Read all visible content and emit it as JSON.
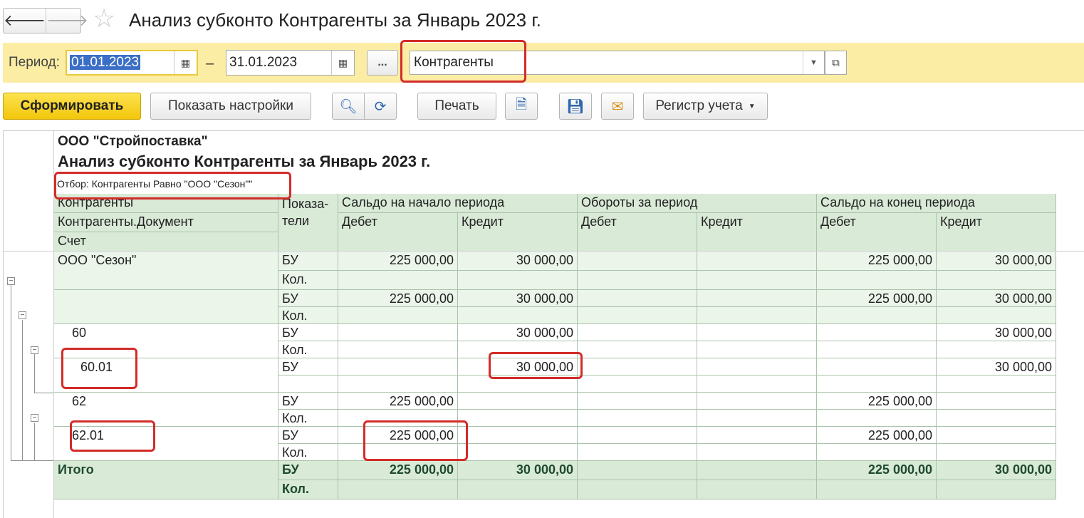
{
  "window": {
    "back_icon": "arrow-left-icon",
    "forward_icon": "arrow-right-icon",
    "favorite_icon": "star-icon",
    "title": "Анализ субконто Контрагенты за Январь 2023 г."
  },
  "period": {
    "label": "Период:",
    "from": "01.01.2023",
    "to": "31.01.2023",
    "dash": "–",
    "dots_label": "...",
    "subconto": "Контрагенты"
  },
  "toolbar": {
    "generate": "Сформировать",
    "show_settings": "Показать настройки",
    "print": "Печать",
    "register": "Регистр учета"
  },
  "report": {
    "org": "ООО \"Стройпоставка\"",
    "title": "Анализ субконто Контрагенты за Январь 2023 г.",
    "filter": "Отбор: Контрагенты Равно \"ООО \"Сезон\"\"",
    "headers": {
      "row_group1": "Контрагенты",
      "row_group2": "Контрагенты.Документ",
      "row_group3": "Счет",
      "indicators": "Показа-\nтели",
      "opening": "Сальдо на начало периода",
      "turnover": "Обороты за период",
      "closing": "Сальдо на конец периода",
      "debit": "Дебет",
      "credit": "Кредит"
    },
    "rows": [
      {
        "name": "ООО \"Сезон\"",
        "ind1": "БУ",
        "ind2": "Кол.",
        "open_dt": "225 000,00",
        "open_kt": "30 000,00",
        "turn_dt": "",
        "turn_kt": "",
        "close_dt": "225 000,00",
        "close_kt": "30 000,00"
      },
      {
        "name": "",
        "ind1": "БУ",
        "ind2": "Кол.",
        "open_dt": "225 000,00",
        "open_kt": "30 000,00",
        "turn_dt": "",
        "turn_kt": "",
        "close_dt": "225 000,00",
        "close_kt": "30 000,00"
      },
      {
        "name": "60",
        "ind1": "БУ",
        "ind2": "Кол.",
        "open_dt": "",
        "open_kt": "30 000,00",
        "turn_dt": "",
        "turn_kt": "",
        "close_dt": "",
        "close_kt": "30 000,00"
      },
      {
        "name": "60.01",
        "ind1": "БУ",
        "ind2": "",
        "open_dt": "",
        "open_kt": "30 000,00",
        "turn_dt": "",
        "turn_kt": "",
        "close_dt": "",
        "close_kt": "30 000,00"
      },
      {
        "name": "62",
        "ind1": "БУ",
        "ind2": "Кол.",
        "open_dt": "225 000,00",
        "open_kt": "",
        "turn_dt": "",
        "turn_kt": "",
        "close_dt": "225 000,00",
        "close_kt": ""
      },
      {
        "name": "62.01",
        "ind1": "БУ",
        "ind2": "Кол.",
        "open_dt": "225 000,00",
        "open_kt": "",
        "turn_dt": "",
        "turn_kt": "",
        "close_dt": "225 000,00",
        "close_kt": ""
      }
    ],
    "total": {
      "name": "Итого",
      "ind1": "БУ",
      "ind2": "Кол.",
      "open_dt": "225 000,00",
      "open_kt": "30 000,00",
      "turn_dt": "",
      "turn_kt": "",
      "close_dt": "225 000,00",
      "close_kt": "30 000,00"
    },
    "collapse_glyph": "−"
  },
  "colors": {
    "period_bar": "#fbeda4",
    "primary_button": "#f2c60b",
    "header_fill": "#d9ead7",
    "group_fill": "#ebf5ea",
    "highlight_frame": "#d22c28",
    "selection": "#3b6ec6"
  }
}
